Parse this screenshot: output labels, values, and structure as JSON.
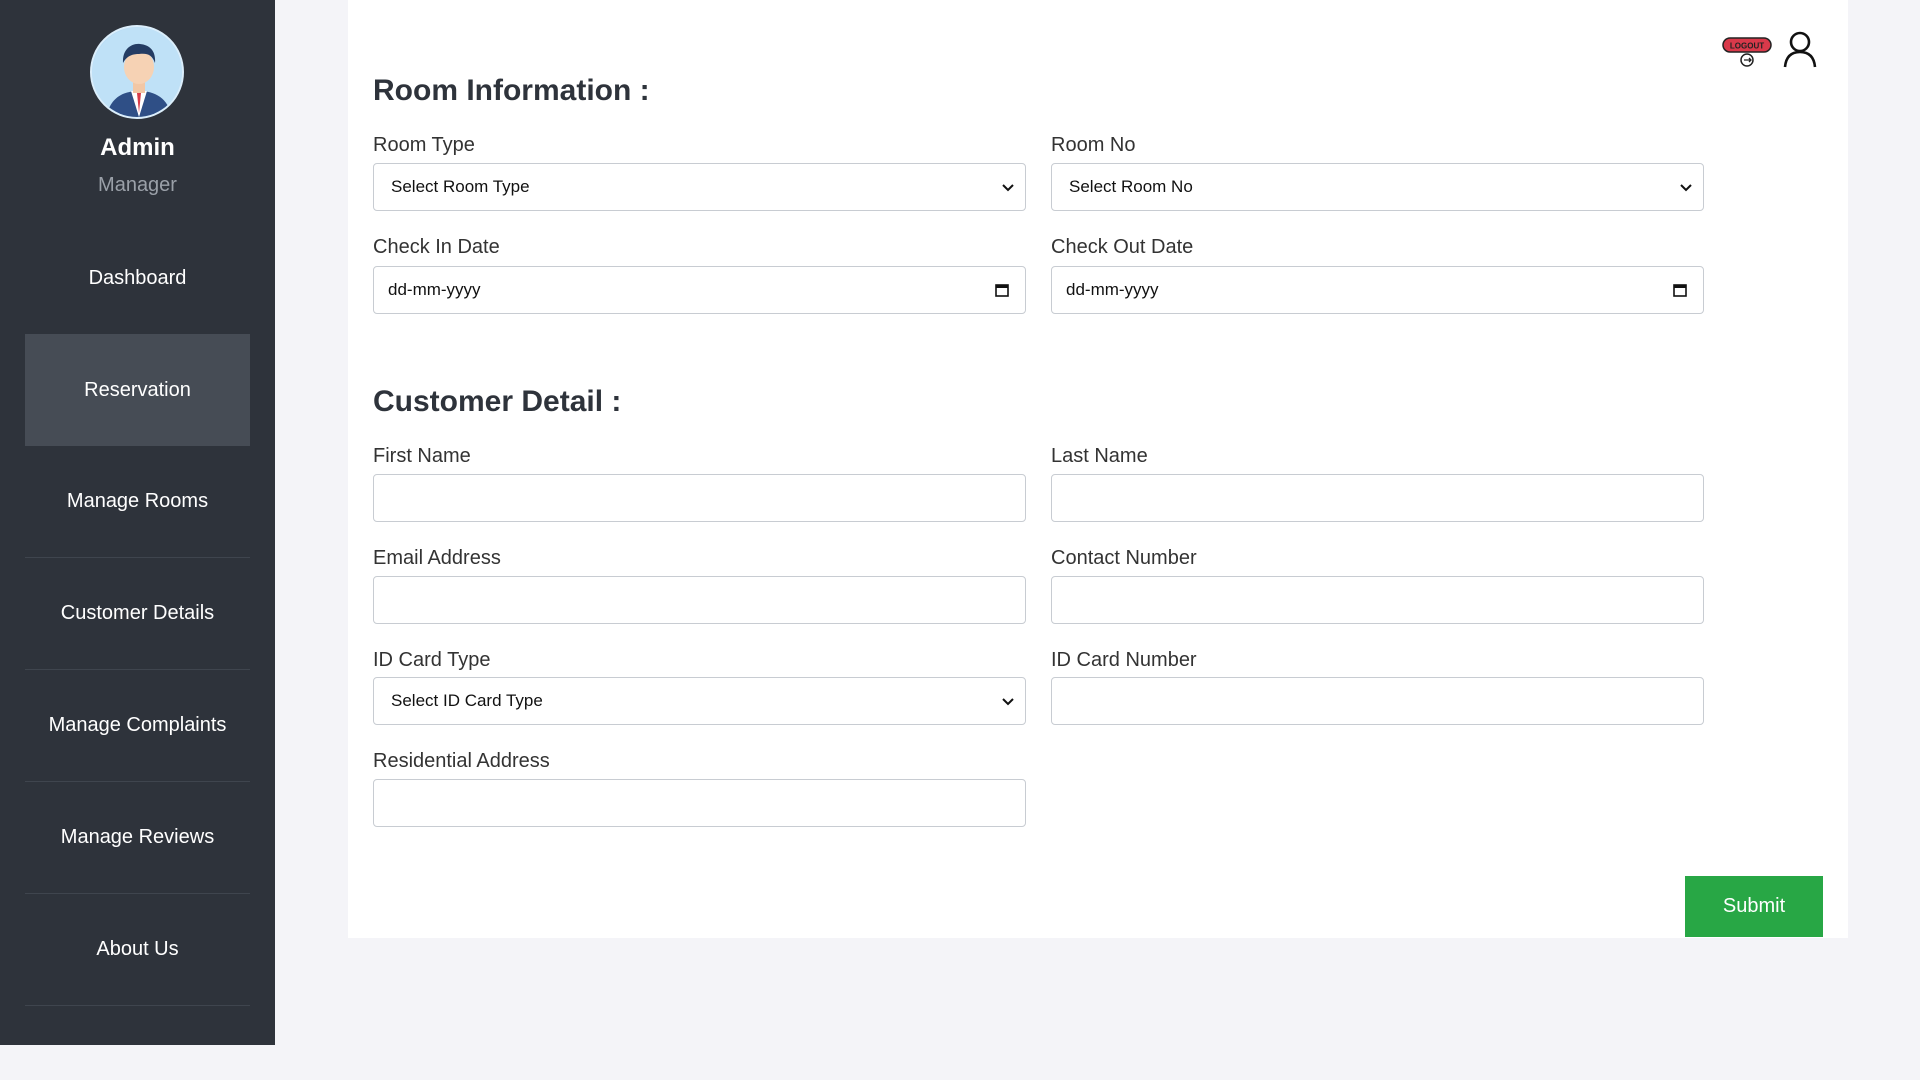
{
  "sidebar": {
    "user_name": "Admin",
    "user_role": "Manager",
    "items": [
      {
        "label": "Dashboard"
      },
      {
        "label": "Reservation"
      },
      {
        "label": "Manage Rooms"
      },
      {
        "label": "Customer Details"
      },
      {
        "label": "Manage Complaints"
      },
      {
        "label": "Manage Reviews"
      },
      {
        "label": "About Us"
      }
    ],
    "active_item": "Reservation"
  },
  "header": {
    "logout_text": "LOGOUT"
  },
  "room_section": {
    "title": "Room Information :",
    "room_type": {
      "label": "Room Type",
      "selected": "Select Room Type"
    },
    "room_no": {
      "label": "Room No",
      "selected": "Select Room No"
    },
    "check_in": {
      "label": "Check In Date",
      "placeholder": "dd-mm-yyyy"
    },
    "check_out": {
      "label": "Check Out Date",
      "placeholder": "dd-mm-yyyy"
    }
  },
  "customer_section": {
    "title": "Customer Detail :",
    "first_name": {
      "label": "First Name",
      "value": ""
    },
    "last_name": {
      "label": "Last Name",
      "value": ""
    },
    "email": {
      "label": "Email Address",
      "value": ""
    },
    "contact": {
      "label": "Contact Number",
      "value": ""
    },
    "id_card_type": {
      "label": "ID Card Type",
      "selected": "Select ID Card Type"
    },
    "id_card_number": {
      "label": "ID Card Number",
      "value": ""
    },
    "address": {
      "label": "Residential Address",
      "value": ""
    }
  },
  "actions": {
    "submit_label": "Submit"
  },
  "colors": {
    "sidebar_bg": "#2e333b",
    "active_nav_bg": "#464c55",
    "submit_bg": "#28a745",
    "page_bg": "#f4f4f8",
    "logout_badge": "#d9394a"
  },
  "icons": [
    "user-avatar-icon",
    "logout-icon",
    "user-icon",
    "chevron-down-icon",
    "calendar-icon"
  ]
}
